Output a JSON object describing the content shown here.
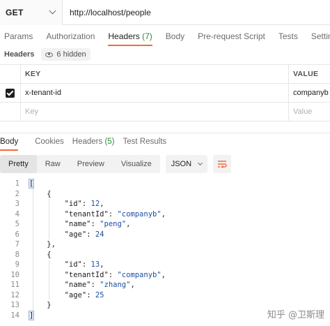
{
  "request": {
    "method": "GET",
    "url": "http://localhost/people"
  },
  "request_tabs": [
    {
      "label": "Params",
      "count": ""
    },
    {
      "label": "Authorization",
      "count": ""
    },
    {
      "label": "Headers",
      "count": "(7)"
    },
    {
      "label": "Body",
      "count": ""
    },
    {
      "label": "Pre-request Script",
      "count": ""
    },
    {
      "label": "Tests",
      "count": ""
    },
    {
      "label": "Settings",
      "count": ""
    }
  ],
  "headers_section": {
    "title": "Headers",
    "hidden_label": "6 hidden",
    "columns": [
      "KEY",
      "VALUE"
    ],
    "rows": [
      {
        "checked": true,
        "key": "x-tenant-id",
        "value": "companyb"
      }
    ],
    "placeholder": {
      "key": "Key",
      "value": "Value"
    }
  },
  "response_tabs": [
    {
      "label": "Body",
      "count": ""
    },
    {
      "label": "Cookies",
      "count": ""
    },
    {
      "label": "Headers",
      "count": "(5)"
    },
    {
      "label": "Test Results",
      "count": ""
    }
  ],
  "view_modes": [
    "Pretty",
    "Raw",
    "Preview",
    "Visualize"
  ],
  "active_view": "Pretty",
  "format": "JSON",
  "code_lines": [
    {
      "n": "1",
      "text": "["
    },
    {
      "n": "2",
      "text": "    {"
    },
    {
      "n": "3",
      "text": "        \"id\": 12,"
    },
    {
      "n": "4",
      "text": "        \"tenantId\": \"companyb\","
    },
    {
      "n": "5",
      "text": "        \"name\": \"peng\","
    },
    {
      "n": "6",
      "text": "        \"age\": 24"
    },
    {
      "n": "7",
      "text": "    },"
    },
    {
      "n": "8",
      "text": "    {"
    },
    {
      "n": "9",
      "text": "        \"id\": 13,"
    },
    {
      "n": "10",
      "text": "        \"tenantId\": \"companyb\","
    },
    {
      "n": "11",
      "text": "        \"name\": \"zhang\","
    },
    {
      "n": "12",
      "text": "        \"age\": 25"
    },
    {
      "n": "13",
      "text": "    }"
    },
    {
      "n": "14",
      "text": "]"
    }
  ],
  "watermark": "知乎 @卫斯理",
  "colors": {
    "accent": "#f26b3a",
    "count_green": "#2f8a3a",
    "json_value_blue": "#1a4fa3"
  }
}
